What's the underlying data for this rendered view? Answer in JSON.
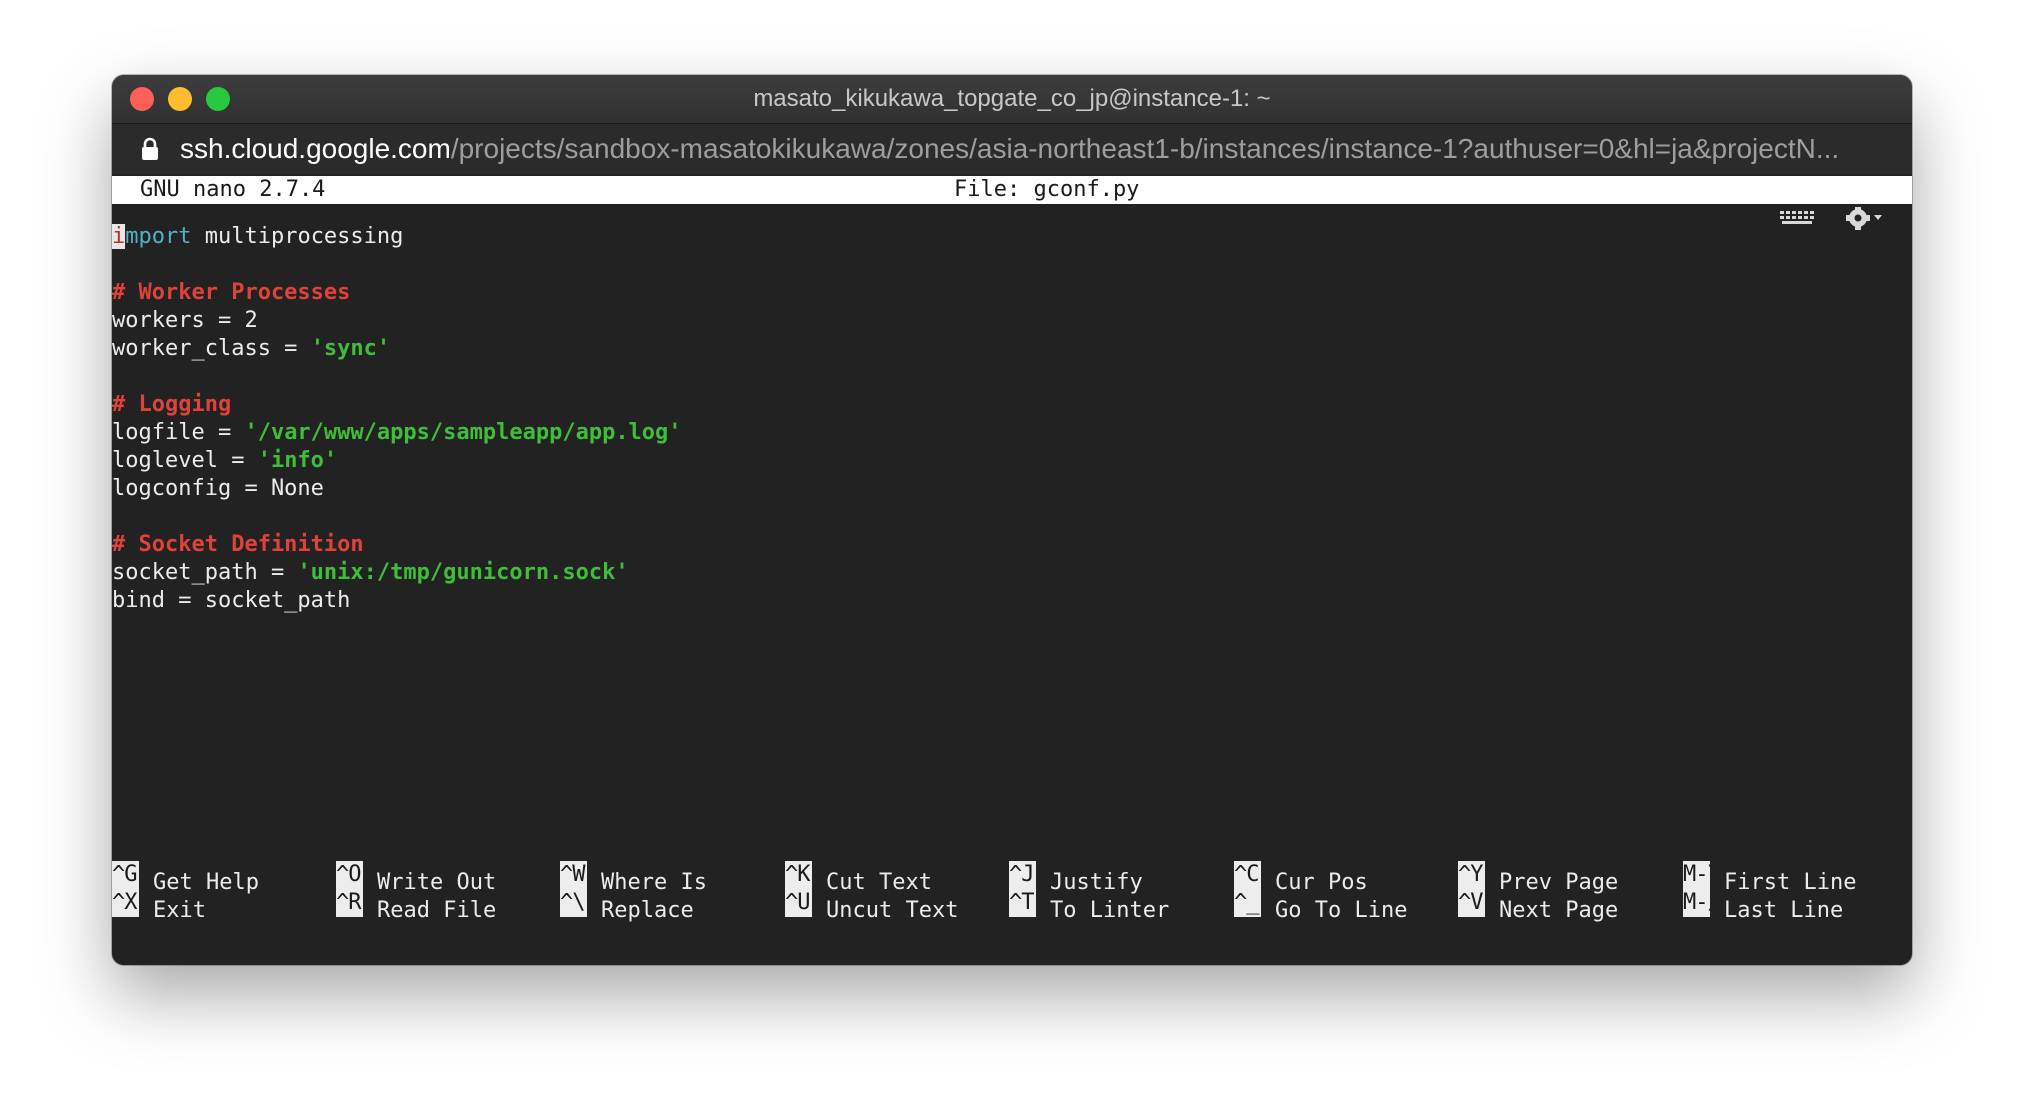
{
  "window": {
    "title": "masato_kikukawa_topgate_co_jp@instance-1: ~"
  },
  "urlbar": {
    "host": "ssh.cloud.google.com",
    "path": "/projects/sandbox-masatokikukawa/zones/asia-northeast1-b/instances/instance-1?authuser=0&hl=ja&projectN..."
  },
  "nano": {
    "version": "GNU nano 2.7.4",
    "file": "File: gconf.py"
  },
  "code": {
    "l1_cursor": "i",
    "l1_kw": "mport",
    "l1_rest": " multiprocessing",
    "c1": "# Worker Processes",
    "l4": "workers = 2",
    "l5_a": "worker_class = ",
    "l5_s": "'sync'",
    "c2": "# Logging",
    "l8_a": "logfile = ",
    "l8_s": "'/var/www/apps/sampleapp/app.log'",
    "l9_a": "loglevel = ",
    "l9_s": "'info'",
    "l10": "logconfig = None",
    "c3": "# Socket Definition",
    "l13_a": "socket_path = ",
    "l13_s": "'unix:/tmp/gunicorn.sock'",
    "l14": "bind = socket_path"
  },
  "shortcuts": [
    {
      "key": "^G",
      "label": "Get Help"
    },
    {
      "key": "^O",
      "label": "Write Out"
    },
    {
      "key": "^W",
      "label": "Where Is"
    },
    {
      "key": "^K",
      "label": "Cut Text"
    },
    {
      "key": "^J",
      "label": "Justify"
    },
    {
      "key": "^C",
      "label": "Cur Pos"
    },
    {
      "key": "^Y",
      "label": "Prev Page"
    },
    {
      "key": "M-\\",
      "label": "First Line"
    },
    {
      "key": "^X",
      "label": "Exit"
    },
    {
      "key": "^R",
      "label": "Read File"
    },
    {
      "key": "^\\",
      "label": "Replace"
    },
    {
      "key": "^U",
      "label": "Uncut Text"
    },
    {
      "key": "^T",
      "label": "To Linter"
    },
    {
      "key": "^_",
      "label": "Go To Line"
    },
    {
      "key": "^V",
      "label": "Next Page"
    },
    {
      "key": "M-/",
      "label": "Last Line"
    }
  ],
  "icons": {
    "lock": "lock-icon",
    "keyboard": "keyboard-icon",
    "settings": "gear-icon"
  }
}
